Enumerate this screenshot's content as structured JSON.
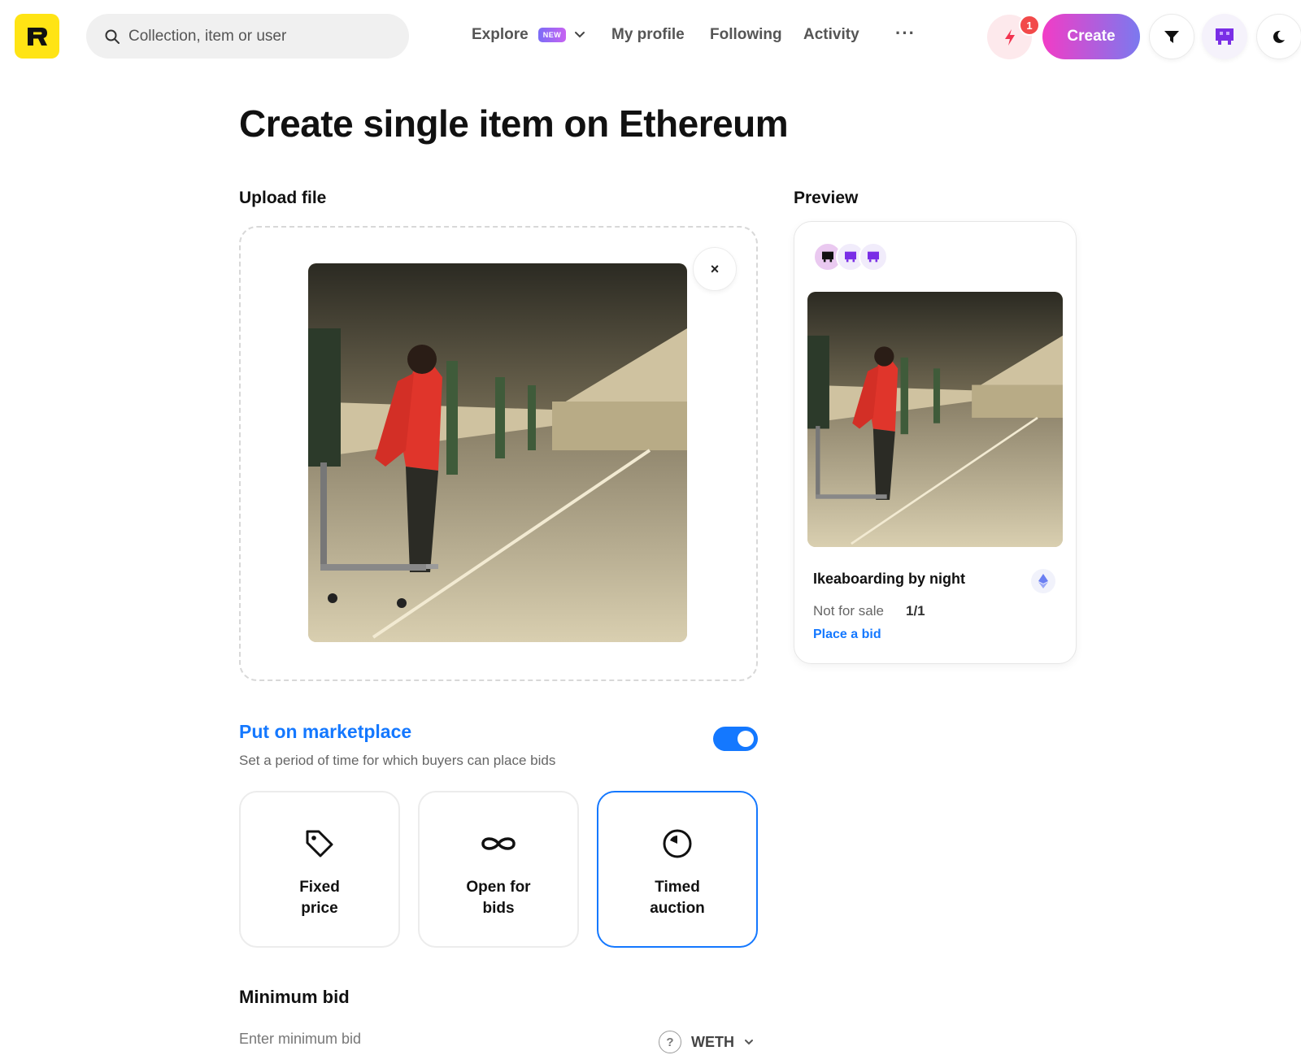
{
  "header": {
    "search_placeholder": "Collection, item or user",
    "nav": {
      "explore": "Explore",
      "explore_badge": "NEW",
      "my_profile": "My profile",
      "following": "Following",
      "activity": "Activity",
      "more": "···"
    },
    "notification_count": "1",
    "create_label": "Create"
  },
  "page": {
    "title": "Create single item on Ethereum",
    "upload_label": "Upload file",
    "preview_label": "Preview",
    "remove_label": "×"
  },
  "preview_card": {
    "item_name": "Ikeaboarding by night",
    "sale_status": "Not for sale",
    "edition": "1/1",
    "place_bid": "Place a bid"
  },
  "marketplace": {
    "title": "Put on marketplace",
    "description": "Set a period of time for which buyers can place bids",
    "enabled": true,
    "options": [
      {
        "label": "Fixed price",
        "icon": "tag-icon",
        "selected": false
      },
      {
        "label": "Open for bids",
        "icon": "infinity-icon",
        "selected": false
      },
      {
        "label": "Timed auction",
        "icon": "clock-icon",
        "selected": true
      }
    ]
  },
  "min_bid": {
    "title": "Minimum bid",
    "placeholder": "Enter minimum bid",
    "currency": "WETH",
    "help": "?"
  },
  "colors": {
    "accent": "#1478ff",
    "logo": "#ffe414",
    "create_gradient_start": "#f23cc6",
    "create_gradient_end": "#7b79ef",
    "notification": "#f24a4a"
  }
}
